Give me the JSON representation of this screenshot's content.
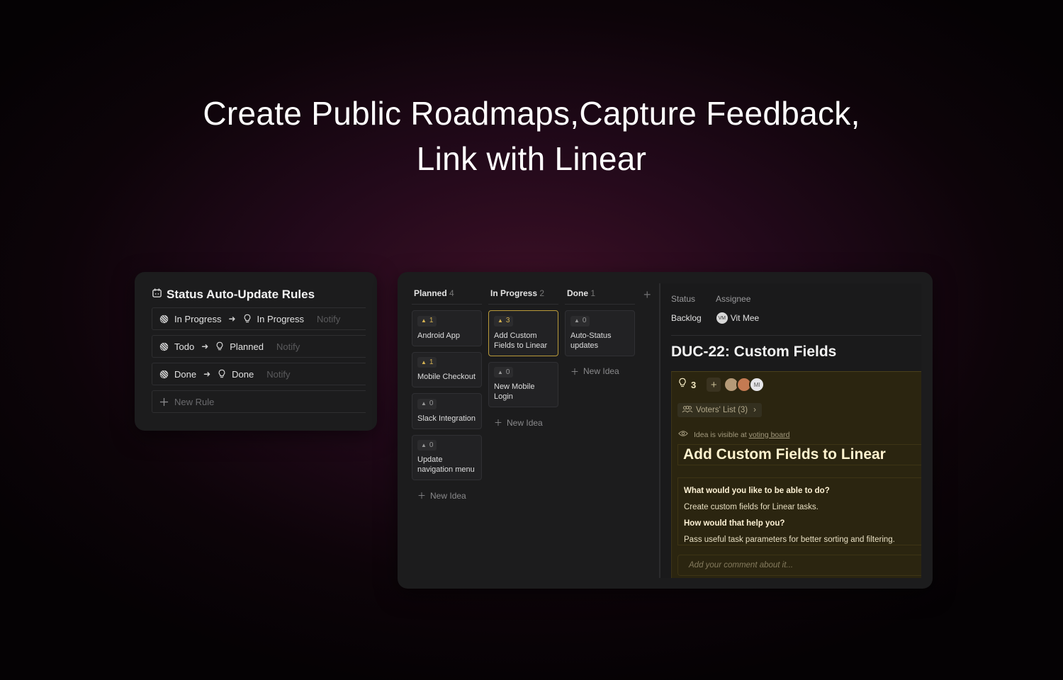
{
  "hero": {
    "line1": "Create Public Roadmaps,Capture Feedback,",
    "line2": "Link with Linear"
  },
  "rules": {
    "title": "Status Auto-Update Rules",
    "items": [
      {
        "from": "In Progress",
        "to": "In Progress",
        "action": "Notify"
      },
      {
        "from": "Todo",
        "to": "Planned",
        "action": "Notify"
      },
      {
        "from": "Done",
        "to": "Done",
        "action": "Notify"
      }
    ],
    "new_rule_label": "New Rule"
  },
  "board": {
    "columns": [
      {
        "name": "Planned",
        "count": "4",
        "cards": [
          {
            "votes": "1",
            "title": "Android App"
          },
          {
            "votes": "1",
            "title": "Mobile Checkout"
          },
          {
            "votes": "0",
            "title": "Slack Integration"
          },
          {
            "votes": "0",
            "title": "Update navigation menu"
          }
        ],
        "new_idea": "New Idea"
      },
      {
        "name": "In Progress",
        "count": "2",
        "cards": [
          {
            "votes": "3",
            "title": "Add Custom Fields to Linear"
          },
          {
            "votes": "0",
            "title": "New Mobile Login"
          }
        ],
        "new_idea": "New Idea"
      },
      {
        "name": "Done",
        "count": "1",
        "cards": [
          {
            "votes": "0",
            "title": "Auto-Status updates"
          }
        ],
        "new_idea": "New Idea"
      }
    ],
    "add_column_label": "+"
  },
  "detail": {
    "status_label": "Status",
    "assignee_label": "Assignee",
    "status_value": "Backlog",
    "assignee_initials": "VM",
    "assignee_name": "Vit Mee",
    "issue_title": "DUC-22: Custom Fields",
    "vote_count": "3",
    "avatar_initials": "MI",
    "voters_label": "Voters' List (3)",
    "visibility_prefix": "Idea is visible at",
    "visibility_link": "voting board",
    "idea_title": "Add Custom Fields to Linear",
    "q1": "What would you like to be able to do?",
    "a1": "Create custom fields for Linear tasks.",
    "q2": "How would that help you?",
    "a2": "Pass useful task parameters for better sorting and filtering.",
    "comment_placeholder": "Add your comment about it..."
  },
  "colors": {
    "accent_gold": "#d6b352",
    "panel_gold": "#2b2510",
    "card_bg": "#1c1c1d"
  }
}
